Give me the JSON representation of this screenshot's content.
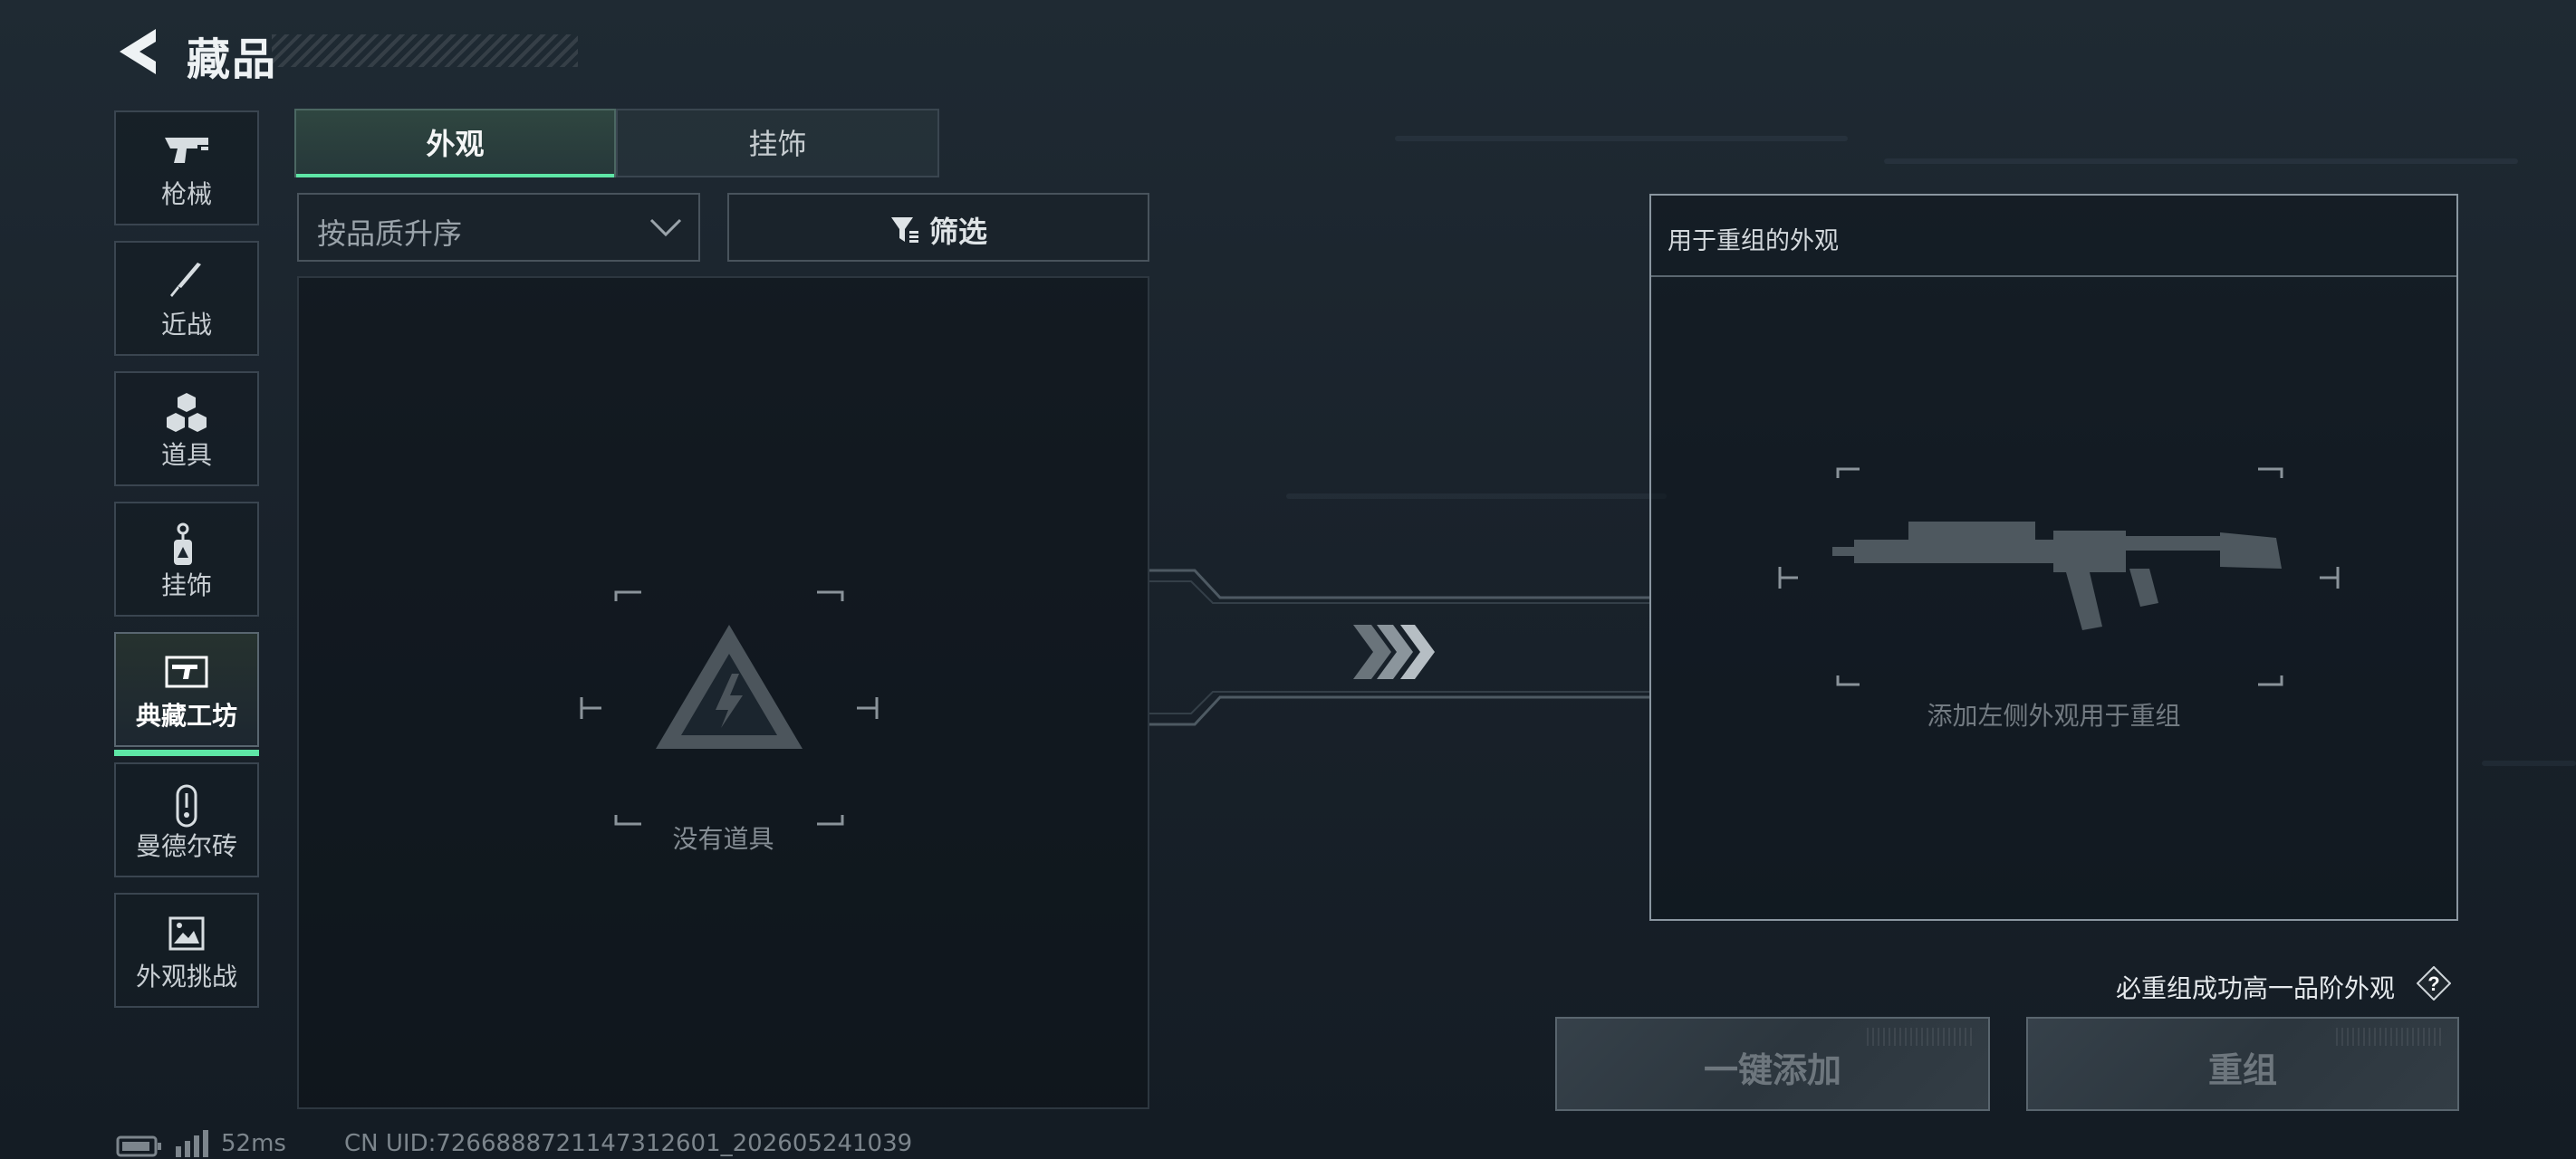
{
  "header": {
    "title": "藏品"
  },
  "sidebar": {
    "items": [
      {
        "label": "枪械",
        "icon": "pistol-icon"
      },
      {
        "label": "近战",
        "icon": "knife-icon"
      },
      {
        "label": "道具",
        "icon": "cubes-icon"
      },
      {
        "label": "挂饰",
        "icon": "charm-tag-icon"
      },
      {
        "label": "典藏工坊",
        "icon": "workshop-gun-card-icon",
        "selected": true
      },
      {
        "label": "曼德尔砖",
        "icon": "mandel-brick-icon"
      },
      {
        "label": "外观挑战",
        "icon": "challenge-image-icon"
      }
    ]
  },
  "tabs": [
    {
      "label": "外观",
      "selected": true
    },
    {
      "label": "挂饰",
      "selected": false
    }
  ],
  "sort": {
    "label": "按品质升序"
  },
  "filter": {
    "label": "筛选"
  },
  "inventory": {
    "empty_text": "没有道具"
  },
  "reassemble_panel": {
    "title": "用于重组的外观",
    "hint": "添加左侧外观用于重组"
  },
  "guarantee_note": "必重组成功高一品阶外观",
  "buttons": {
    "quick_add": "一键添加",
    "reassemble": "重组"
  },
  "status": {
    "ping": "52ms",
    "uid": "CN UID:7266888721147312601_202605241039"
  },
  "colors": {
    "accent": "#5ee6a6"
  }
}
